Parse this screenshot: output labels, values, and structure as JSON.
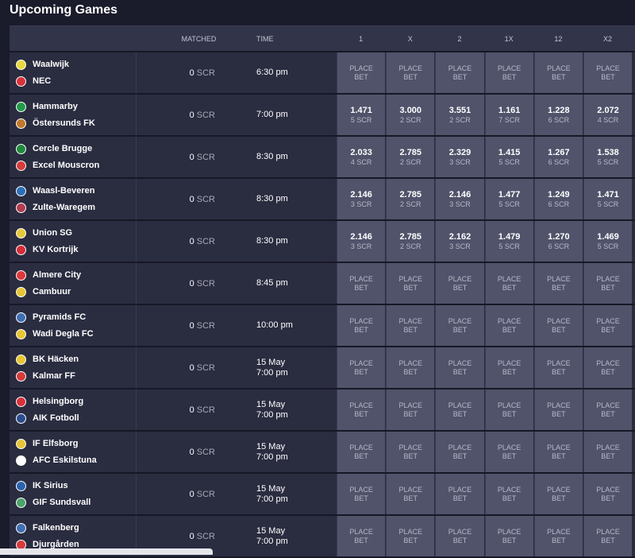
{
  "page": {
    "title": "Upcoming Games"
  },
  "header": {
    "teams": "",
    "matched": "MATCHED",
    "time": "TIME",
    "odds": [
      "1",
      "X",
      "2",
      "1X",
      "12",
      "X2"
    ]
  },
  "place_bet": [
    "PLACE",
    "BET"
  ],
  "unit": "SCR",
  "colors": {
    "background": "#1a1b2b",
    "row": "#2a2c40",
    "odd_cell": "#50536a"
  },
  "games": [
    {
      "home": "Waalwijk",
      "away": "NEC",
      "home_badge": "#e8d93c",
      "away_badge": "#d8313a",
      "matched": "0",
      "time": [
        "6:30 pm"
      ],
      "odds": [
        null,
        null,
        null,
        null,
        null,
        null
      ]
    },
    {
      "home": "Hammarby",
      "away": "Östersunds FK",
      "home_badge": "#1f9b4a",
      "away_badge": "#c1782a",
      "matched": "0",
      "time": [
        "7:00 pm"
      ],
      "odds": [
        {
          "v": "1.471",
          "s": "5"
        },
        {
          "v": "3.000",
          "s": "2"
        },
        {
          "v": "3.551",
          "s": "2"
        },
        {
          "v": "1.161",
          "s": "7"
        },
        {
          "v": "1.228",
          "s": "6"
        },
        {
          "v": "2.072",
          "s": "4"
        }
      ]
    },
    {
      "home": "Cercle Brugge",
      "away": "Excel Mouscron",
      "home_badge": "#1f8a3c",
      "away_badge": "#d83b3b",
      "matched": "0",
      "time": [
        "8:30 pm"
      ],
      "odds": [
        {
          "v": "2.033",
          "s": "4"
        },
        {
          "v": "2.785",
          "s": "2"
        },
        {
          "v": "2.329",
          "s": "3"
        },
        {
          "v": "1.415",
          "s": "5"
        },
        {
          "v": "1.267",
          "s": "6"
        },
        {
          "v": "1.538",
          "s": "5"
        }
      ]
    },
    {
      "home": "Waasl-Beveren",
      "away": "Zulte-Waregem",
      "home_badge": "#2b6fb8",
      "away_badge": "#b23b52",
      "matched": "0",
      "time": [
        "8:30 pm"
      ],
      "odds": [
        {
          "v": "2.146",
          "s": "3"
        },
        {
          "v": "2.785",
          "s": "2"
        },
        {
          "v": "2.146",
          "s": "3"
        },
        {
          "v": "1.477",
          "s": "5"
        },
        {
          "v": "1.249",
          "s": "6"
        },
        {
          "v": "1.471",
          "s": "5"
        }
      ]
    },
    {
      "home": "Union SG",
      "away": "KV Kortrijk",
      "home_badge": "#e7c93a",
      "away_badge": "#d62d36",
      "matched": "0",
      "time": [
        "8:30 pm"
      ],
      "odds": [
        {
          "v": "2.146",
          "s": "3"
        },
        {
          "v": "2.785",
          "s": "2"
        },
        {
          "v": "2.162",
          "s": "3"
        },
        {
          "v": "1.479",
          "s": "5"
        },
        {
          "v": "1.270",
          "s": "6"
        },
        {
          "v": "1.469",
          "s": "5"
        }
      ]
    },
    {
      "home": "Almere City",
      "away": "Cambuur",
      "home_badge": "#e0373a",
      "away_badge": "#e8c634",
      "matched": "0",
      "time": [
        "8:45 pm"
      ],
      "odds": [
        null,
        null,
        null,
        null,
        null,
        null
      ]
    },
    {
      "home": "Pyramids FC",
      "away": "Wadi Degla FC",
      "home_badge": "#3d6fb5",
      "away_badge": "#e8c634",
      "matched": "0",
      "time": [
        "10:00 pm"
      ],
      "odds": [
        null,
        null,
        null,
        null,
        null,
        null
      ]
    },
    {
      "home": "BK Häcken",
      "away": "Kalmar FF",
      "home_badge": "#e8c634",
      "away_badge": "#d63a3a",
      "matched": "0",
      "time": [
        "15 May",
        "7:00 pm"
      ],
      "odds": [
        null,
        null,
        null,
        null,
        null,
        null
      ]
    },
    {
      "home": "Helsingborg",
      "away": "AIK Fotboll",
      "home_badge": "#d8313a",
      "away_badge": "#2a4d8f",
      "matched": "0",
      "time": [
        "15 May",
        "7:00 pm"
      ],
      "odds": [
        null,
        null,
        null,
        null,
        null,
        null
      ]
    },
    {
      "home": "IF Elfsborg",
      "away": "AFC Eskilstuna",
      "home_badge": "#e8c634",
      "away_badge": "#ffffff",
      "matched": "0",
      "time": [
        "15 May",
        "7:00 pm"
      ],
      "odds": [
        null,
        null,
        null,
        null,
        null,
        null
      ]
    },
    {
      "home": "IK Sirius",
      "away": "GIF Sundsvall",
      "home_badge": "#2b62b0",
      "away_badge": "#4aa36a",
      "matched": "0",
      "time": [
        "15 May",
        "7:00 pm"
      ],
      "odds": [
        null,
        null,
        null,
        null,
        null,
        null
      ]
    },
    {
      "home": "Falkenberg",
      "away": "Djurgården",
      "home_badge": "#3f6fb0",
      "away_badge": "#d83b3b",
      "matched": "0",
      "time": [
        "15 May",
        "7:00 pm"
      ],
      "odds": [
        null,
        null,
        null,
        null,
        null,
        null
      ]
    }
  ]
}
